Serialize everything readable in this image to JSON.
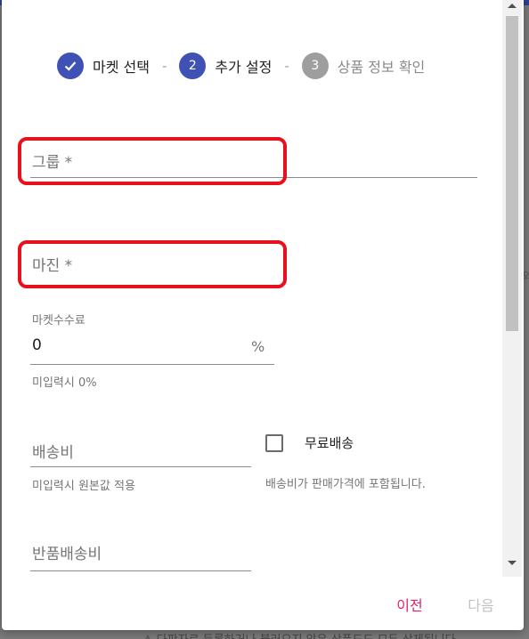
{
  "stepper": {
    "steps": [
      {
        "number": "✓",
        "label": "마켓 선택",
        "state": "done"
      },
      {
        "number": "2",
        "label": "추가 설정",
        "state": "active"
      },
      {
        "number": "3",
        "label": "상품 정보 확인",
        "state": "inactive"
      }
    ],
    "separator": "-"
  },
  "form": {
    "group": {
      "label": "그룹 *"
    },
    "margin": {
      "label": "마진 *"
    },
    "market_fee": {
      "label": "마켓수수료",
      "value": "0",
      "suffix": "%",
      "helper": "미입력시 0%"
    },
    "shipping_fee": {
      "label": "배송비",
      "helper": "미입력시 원본값 적용"
    },
    "free_shipping": {
      "label": "무료배송",
      "helper": "배송비가 판매가격에 포함됩니다.",
      "checked": false
    },
    "return_fee": {
      "label": "반품배송비"
    }
  },
  "actions": {
    "prev": "이전",
    "next": "다음"
  },
  "background": {
    "bottom_text": "⚠ 다판자로 등록하거나 불러오지 않은 상품도도 모두 삭제됩니다"
  },
  "colors": {
    "primary": "#3f51b5",
    "accent": "#e0236b",
    "highlight": "#e8101c"
  }
}
